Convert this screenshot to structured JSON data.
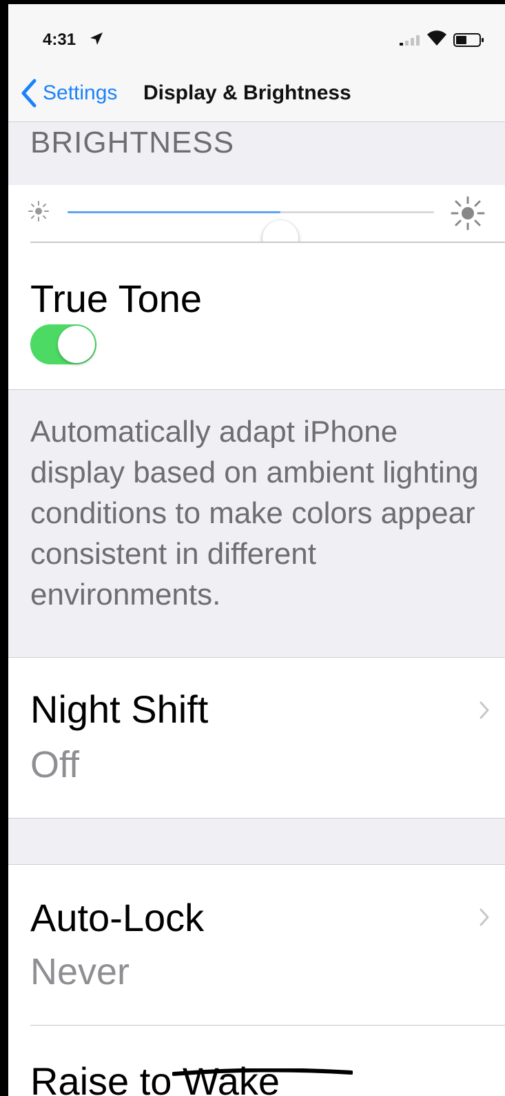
{
  "status_bar": {
    "time": "4:31",
    "icons": [
      "location-arrow-icon",
      "signal-icon",
      "wifi-icon",
      "battery-icon"
    ]
  },
  "nav": {
    "back_label": "Settings",
    "title": "Display & Brightness"
  },
  "brightness": {
    "section_header": "BRIGHTNESS",
    "level": 0.58,
    "accent_color": "#5ca3f7"
  },
  "true_tone": {
    "title": "True Tone",
    "enabled": true,
    "toggle_color": "#4cd964",
    "description": "Automatically adapt iPhone display based on ambient lighting conditions to make colors appear consistent in different environments."
  },
  "night_shift": {
    "title": "Night Shift",
    "value": "Off"
  },
  "auto_lock": {
    "title": "Auto-Lock",
    "value": "Never"
  },
  "raise_to_wake": {
    "title": "Raise to Wake"
  }
}
